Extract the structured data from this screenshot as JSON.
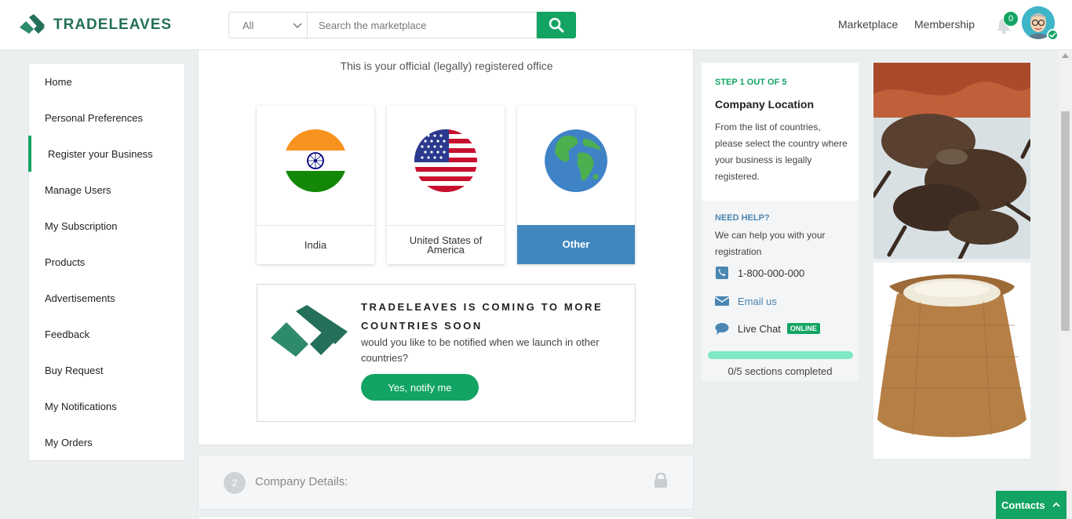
{
  "brand": {
    "name": "TRADELEAVES",
    "primary_color": "#13a463",
    "dark_green": "#24705a",
    "blue": "#4187bf"
  },
  "header": {
    "search": {
      "category": "All",
      "placeholder": "Search the marketplace"
    },
    "nav": [
      "Marketplace",
      "Membership"
    ],
    "notification_count": "0"
  },
  "sidebar": {
    "items": [
      {
        "label": "Home"
      },
      {
        "label": "Personal Preferences"
      },
      {
        "label": "Register your Business",
        "active": true
      },
      {
        "label": "Manage Users"
      },
      {
        "label": "My Subscription"
      },
      {
        "label": "Products"
      },
      {
        "label": "Advertisements"
      },
      {
        "label": "Feedback"
      },
      {
        "label": "Buy Request"
      },
      {
        "label": "My Notifications"
      },
      {
        "label": "My Orders"
      }
    ]
  },
  "main": {
    "subtitle": "This is your official (legally) registered office",
    "countries": [
      {
        "label": "India",
        "icon": "india-flag-icon"
      },
      {
        "label": "United States of America",
        "icon": "usa-flag-icon"
      },
      {
        "label": "Other",
        "icon": "globe-icon",
        "selected": true
      }
    ],
    "notify": {
      "title": "TRADELEAVES IS COMING TO MORE COUNTRIES SOON",
      "text": "would you like to be notified when we launch in other countries?",
      "button": "Yes, notify me"
    },
    "next_section": {
      "number": "2",
      "title": "Company Details:"
    }
  },
  "info": {
    "step": "STEP 1 OUT OF 5",
    "title": "Company Location",
    "description": "From the list of countries, please select the country where your business is legally registered.",
    "help_label": "NEED HELP?",
    "help_text": "We can help you with your registration",
    "phone": "1-800-000-000",
    "email": "Email us",
    "chat": "Live Chat",
    "chat_status": "ONLINE",
    "progress_text": "0/5 sections completed",
    "progress_fraction": 0
  },
  "contacts_button": "Contacts"
}
